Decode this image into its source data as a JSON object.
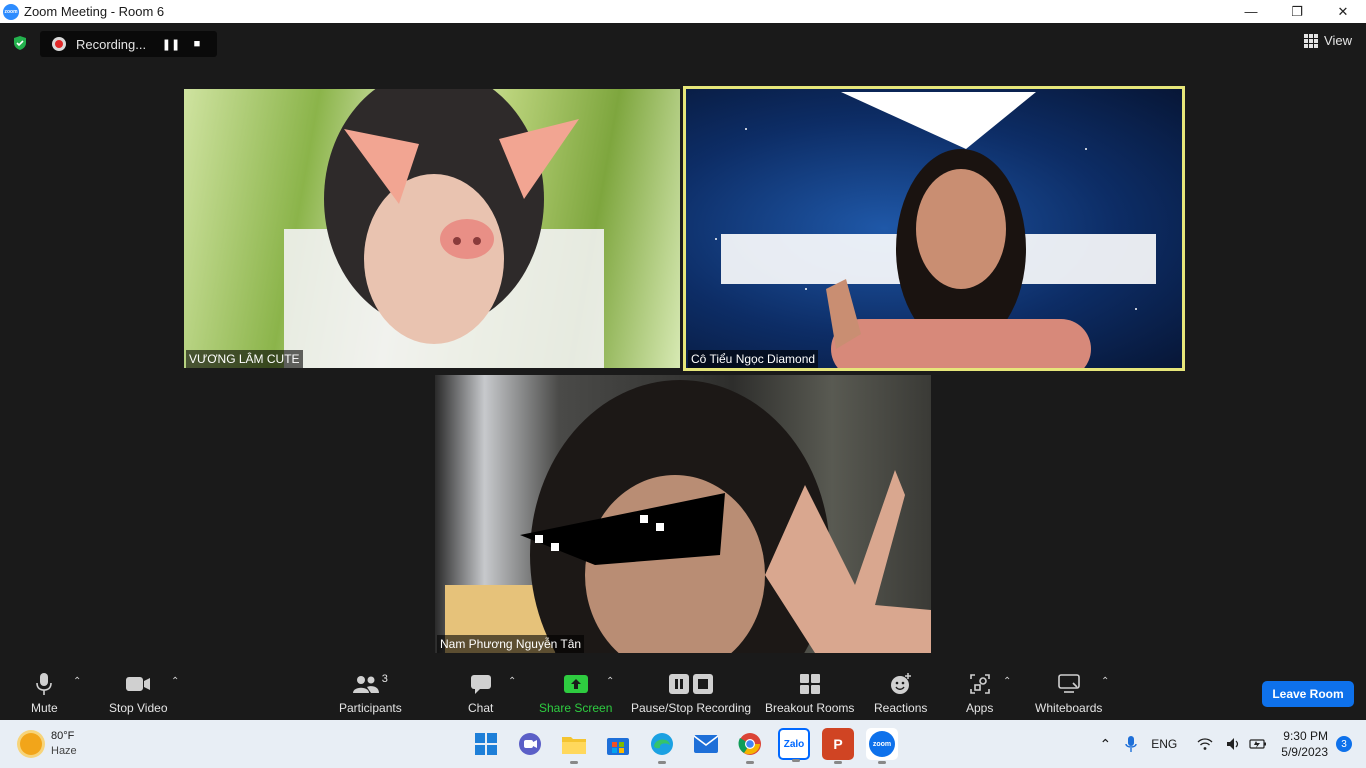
{
  "window": {
    "title": "Zoom Meeting - Room 6",
    "app_icon_text": "zoom",
    "controls": [
      "minimize-icon",
      "maximize-icon",
      "close-icon"
    ]
  },
  "meeting": {
    "recording_label": "Recording...",
    "view_label": "View",
    "active_speaker_border_color": "#e6e67a",
    "participants": [
      {
        "name": "VƯƠNG LÂM CUTE"
      },
      {
        "name": "Cô Tiểu Ngọc Diamond",
        "active_speaker": true
      },
      {
        "name": "Nam Phương Nguyễn Tân"
      }
    ]
  },
  "toolbar": {
    "mute": "Mute",
    "stop_video": "Stop Video",
    "participants": "Participants",
    "participants_count": "3",
    "chat": "Chat",
    "share_screen": "Share Screen",
    "pause_stop_recording": "Pause/Stop Recording",
    "breakout_rooms": "Breakout Rooms",
    "reactions": "Reactions",
    "apps": "Apps",
    "whiteboards": "Whiteboards",
    "leave": "Leave Room",
    "share_color": "#2ecc40",
    "leave_color": "#0e71eb"
  },
  "taskbar": {
    "weather_temp": "80°F",
    "weather_desc": "Haze",
    "apps": [
      {
        "name": "windows-start",
        "icon": "windows-icon"
      },
      {
        "name": "meet",
        "icon": "video-call-icon"
      },
      {
        "name": "file-explorer",
        "icon": "folder-icon"
      },
      {
        "name": "store",
        "icon": "store-icon"
      },
      {
        "name": "edge",
        "icon": "edge-icon"
      },
      {
        "name": "mail",
        "icon": "mail-icon"
      },
      {
        "name": "chrome",
        "icon": "chrome-icon"
      },
      {
        "name": "zalo",
        "icon": "zalo-icon",
        "label": "Zalo"
      },
      {
        "name": "powerpoint",
        "icon": "powerpoint-icon",
        "label": "P"
      },
      {
        "name": "zoom",
        "icon": "zoom-icon",
        "label": "zoom"
      }
    ],
    "language": "ENG",
    "time": "9:30 PM",
    "date": "5/9/2023",
    "notifications": "3"
  }
}
